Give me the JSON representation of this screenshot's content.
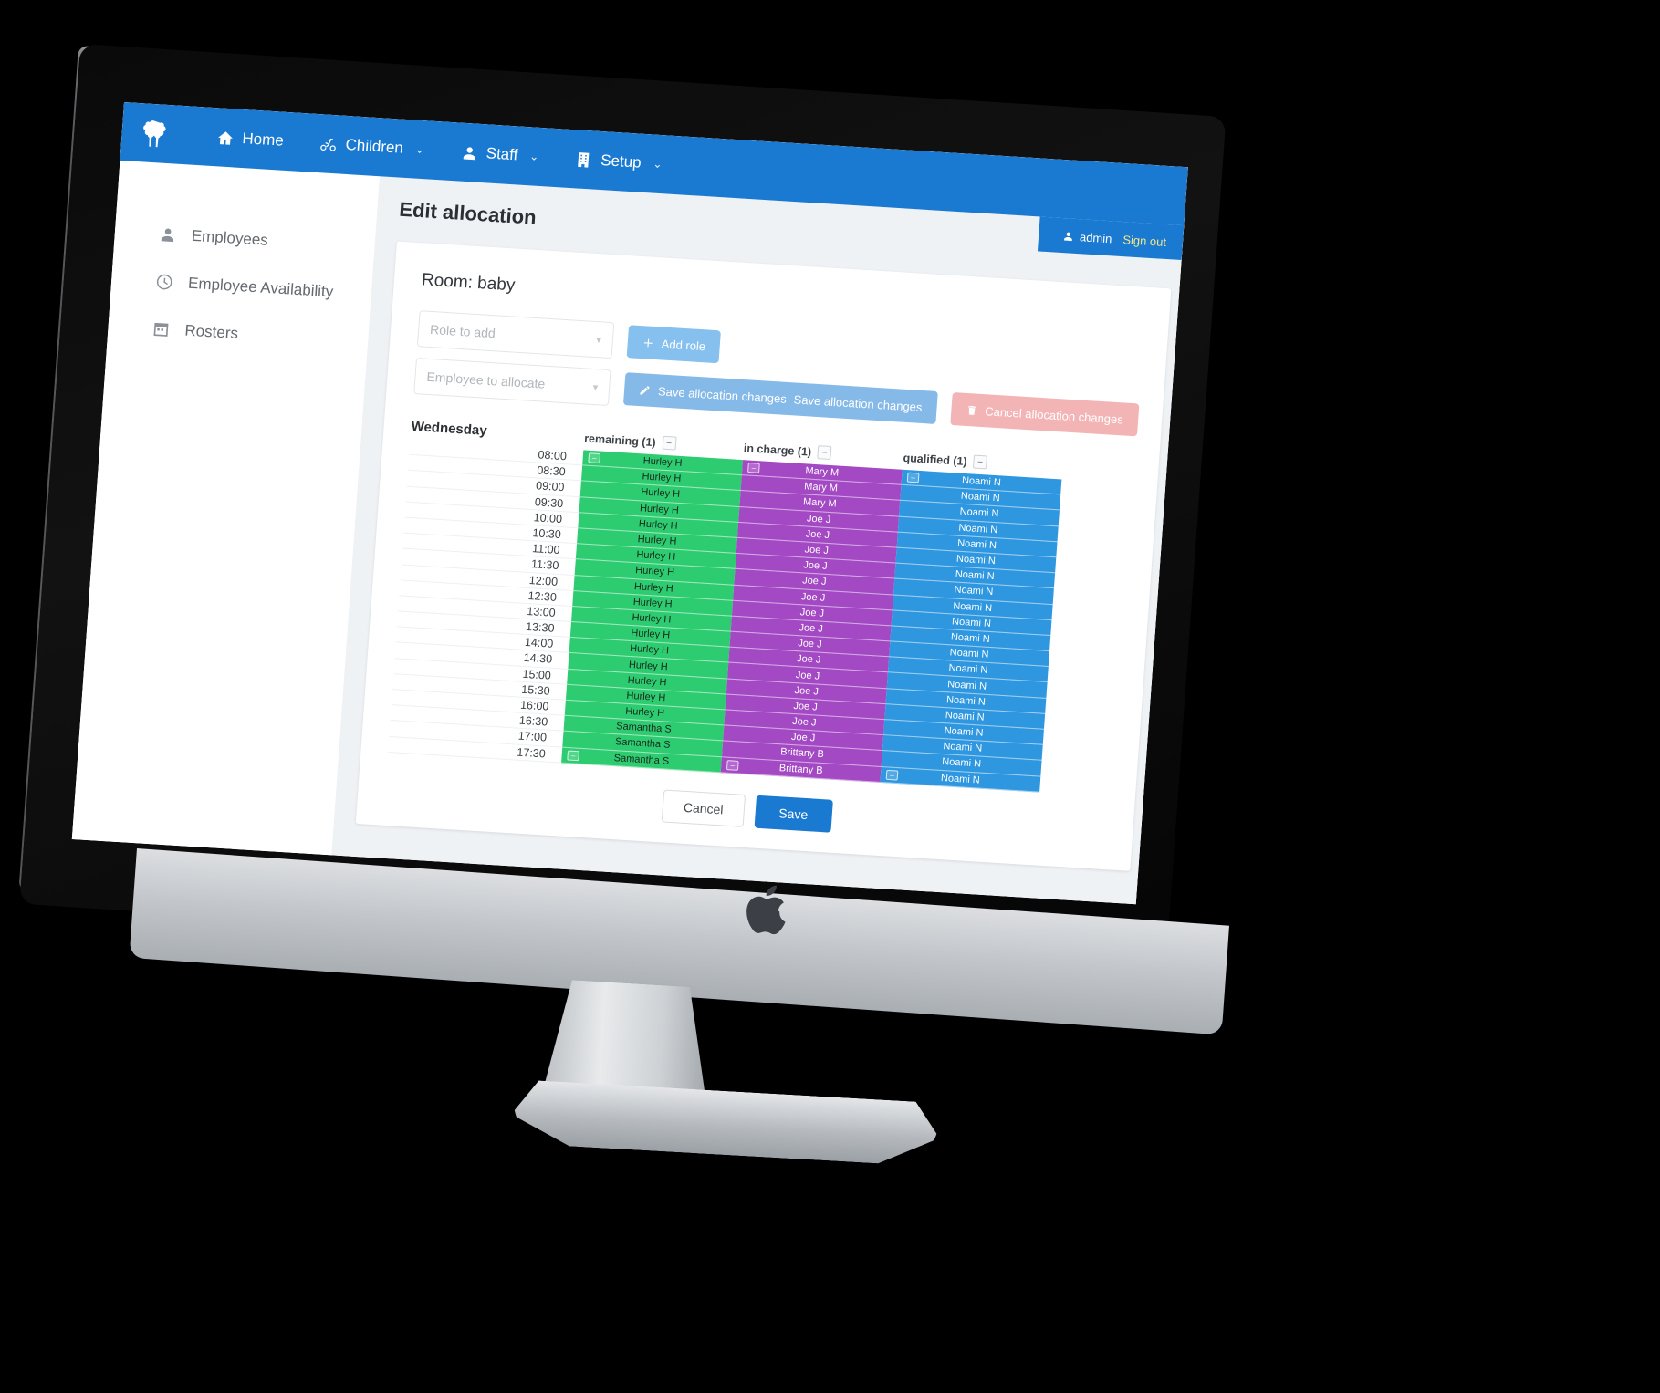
{
  "app": {
    "brand_icon": "brain-logo-icon"
  },
  "topnav": {
    "items": [
      {
        "label": "Home",
        "icon": "home-icon",
        "caret": ""
      },
      {
        "label": "Children",
        "icon": "children-icon",
        "caret": "⌄"
      },
      {
        "label": "Staff",
        "icon": "person-icon",
        "caret": "⌄"
      },
      {
        "label": "Setup",
        "icon": "building-icon",
        "caret": "⌄"
      }
    ]
  },
  "userbar": {
    "username": "admin",
    "signout_label": "Sign out"
  },
  "sidebar": {
    "items": [
      {
        "label": "Employees",
        "icon": "person-icon"
      },
      {
        "label": "Employee Availability",
        "icon": "clock-icon"
      },
      {
        "label": "Rosters",
        "icon": "calendar-icon"
      }
    ]
  },
  "page": {
    "title": "Edit allocation",
    "room_title": "Room: baby"
  },
  "form": {
    "role_select_placeholder": "Role to add",
    "add_role_label": "Add role",
    "employee_select_placeholder": "Employee to allocate",
    "save_allocation_label": "Save allocation changes",
    "cancel_allocation_label": "Cancel allocation changes"
  },
  "footer": {
    "cancel_label": "Cancel",
    "save_label": "Save"
  },
  "colors": {
    "brand_blue": "#1a7ad1",
    "remaining_green": "#2ecc71",
    "in_charge_purple": "#a349c4",
    "qualified_blue": "#2f97e0",
    "btn_light_blue": "#85c0ef",
    "btn_pink": "#f3b4b6",
    "signout_yellow": "#f0e68c"
  },
  "schedule": {
    "day": "Wednesday",
    "minus_glyph": "–",
    "columns": [
      {
        "label": "remaining (1)",
        "color_key": "remaining_green"
      },
      {
        "label": "in charge (1)",
        "color_key": "in_charge_purple"
      },
      {
        "label": "qualified (1)",
        "color_key": "qualified_blue"
      }
    ],
    "times": [
      "08:00",
      "08:30",
      "09:00",
      "09:30",
      "10:00",
      "10:30",
      "11:00",
      "11:30",
      "12:00",
      "12:30",
      "13:00",
      "13:30",
      "14:00",
      "14:30",
      "15:00",
      "15:30",
      "16:00",
      "16:30",
      "17:00",
      "17:30"
    ],
    "remaining": [
      "Hurley H",
      "Hurley H",
      "Hurley H",
      "Hurley H",
      "Hurley H",
      "Hurley H",
      "Hurley H",
      "Hurley H",
      "Hurley H",
      "Hurley H",
      "Hurley H",
      "Hurley H",
      "Hurley H",
      "Hurley H",
      "Hurley H",
      "Hurley H",
      "Hurley H",
      "Samantha S",
      "Samantha S",
      "Samantha S"
    ],
    "in_charge": [
      "Mary M",
      "Mary M",
      "Mary M",
      "Joe J",
      "Joe J",
      "Joe J",
      "Joe J",
      "Joe J",
      "Joe J",
      "Joe J",
      "Joe J",
      "Joe J",
      "Joe J",
      "Joe J",
      "Joe J",
      "Joe J",
      "Joe J",
      "Joe J",
      "Brittany B",
      "Brittany B"
    ],
    "qualified": [
      "Noami N",
      "Noami N",
      "Noami N",
      "Noami N",
      "Noami N",
      "Noami N",
      "Noami N",
      "Noami N",
      "Noami N",
      "Noami N",
      "Noami N",
      "Noami N",
      "Noami N",
      "Noami N",
      "Noami N",
      "Noami N",
      "Noami N",
      "Noami N",
      "Noami N",
      "Noami N"
    ]
  }
}
